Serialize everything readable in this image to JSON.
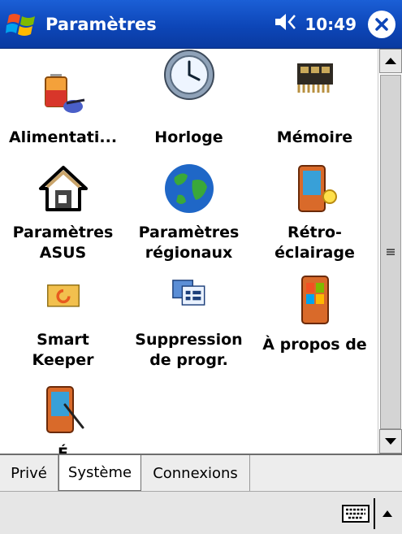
{
  "titlebar": {
    "title": "Paramètres",
    "time": "10:49",
    "icons": {
      "start": "windows-flag-icon",
      "volume": "speaker-icon",
      "close": "close-icon"
    },
    "close_glyph": "✕",
    "volume_glyph": "◀€"
  },
  "settings_items": [
    {
      "label": "Alimentati...",
      "icon": "battery-icon"
    },
    {
      "label": "Horloge",
      "icon": "clock-icon"
    },
    {
      "label": "Mémoire",
      "icon": "memory-chip-icon"
    },
    {
      "label": "Paramètres\nASUS",
      "icon": "house-icon"
    },
    {
      "label": "Paramètres\nrégionaux",
      "icon": "globe-icon"
    },
    {
      "label": "Rétro-\néclairage",
      "icon": "backlight-device-icon"
    },
    {
      "label": "Smart\nKeeper",
      "icon": "folder-refresh-icon"
    },
    {
      "label": "Suppression\nde progr.",
      "icon": "remove-programs-icon"
    },
    {
      "label": "À propos de",
      "icon": "about-device-icon"
    },
    {
      "label": "É",
      "icon": "stylus-screen-icon"
    }
  ],
  "tabs": [
    {
      "label": "Privé",
      "active": false
    },
    {
      "label": "Système",
      "active": true
    },
    {
      "label": "Connexions",
      "active": false
    }
  ],
  "colors": {
    "titlebar": "#0d46b8",
    "background": "#ffffff"
  }
}
